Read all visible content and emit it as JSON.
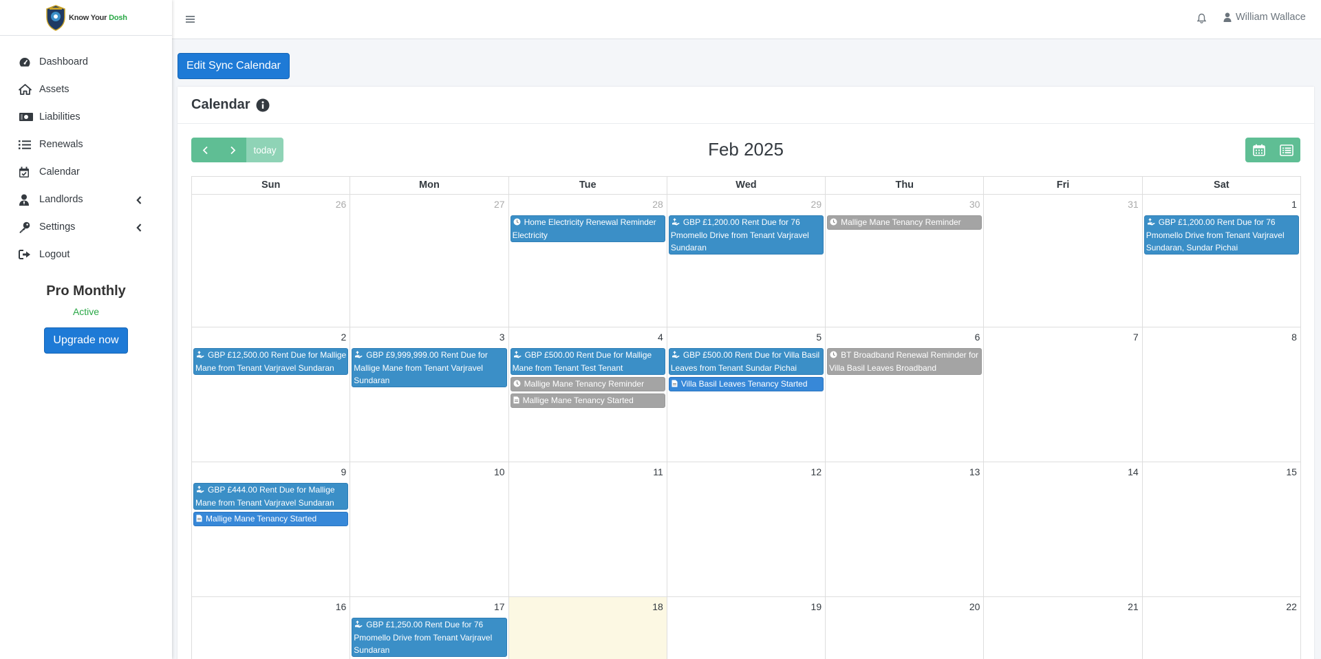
{
  "brand": {
    "name_part1": "Know Your ",
    "name_part2": "Dosh"
  },
  "sidebar": {
    "items": [
      {
        "label": "Dashboard",
        "icon": "tachometer-icon"
      },
      {
        "label": "Assets",
        "icon": "home-icon"
      },
      {
        "label": "Liabilities",
        "icon": "money-icon"
      },
      {
        "label": "Renewals",
        "icon": "list-icon"
      },
      {
        "label": "Calendar",
        "icon": "calendar-check-icon"
      },
      {
        "label": "Landlords",
        "icon": "user-tie-icon",
        "has_children": true
      },
      {
        "label": "Settings",
        "icon": "key-icon",
        "has_children": true
      },
      {
        "label": "Logout",
        "icon": "sign-out-icon"
      }
    ],
    "plan": {
      "name": "Pro Monthly",
      "status": "Active",
      "upgrade_label": "Upgrade now"
    }
  },
  "navbar": {
    "user_name": "William Wallace"
  },
  "content": {
    "sync_button": "Edit Sync Calendar",
    "card_title": "Calendar"
  },
  "calendar": {
    "title": "Feb 2025",
    "today_label": "today",
    "days_of_week": [
      "Sun",
      "Mon",
      "Tue",
      "Wed",
      "Thu",
      "Fri",
      "Sat"
    ],
    "weeks": [
      [
        {
          "num": "26",
          "other": true,
          "events": []
        },
        {
          "num": "27",
          "other": true,
          "events": []
        },
        {
          "num": "28",
          "other": true,
          "events": [
            {
              "kind": "blue",
              "icon": "clock",
              "text": "Home Electricity Renewal Reminder Electricity"
            }
          ]
        },
        {
          "num": "29",
          "other": true,
          "events": [
            {
              "kind": "blue",
              "icon": "hand",
              "text": "GBP £1,200.00 Rent Due for 76 Pmomello Drive from Tenant Varjravel Sundaran"
            }
          ]
        },
        {
          "num": "30",
          "other": true,
          "events": [
            {
              "kind": "grey",
              "icon": "clock",
              "text": "Mallige Mane Tenancy Reminder"
            }
          ]
        },
        {
          "num": "31",
          "other": true,
          "events": []
        },
        {
          "num": "1",
          "events": [
            {
              "kind": "blue",
              "icon": "hand",
              "text": "GBP £1,200.00 Rent Due for 76 Pmomello Drive from Tenant Varjravel Sundaran, Sundar Pichai"
            }
          ]
        }
      ],
      [
        {
          "num": "2",
          "events": [
            {
              "kind": "blue",
              "icon": "hand",
              "text": "GBP £12,500.00 Rent Due for Mallige Mane from Tenant Varjravel Sundaran"
            }
          ]
        },
        {
          "num": "3",
          "events": [
            {
              "kind": "blue",
              "icon": "hand",
              "text": "GBP £9,999,999.00 Rent Due for Mallige Mane from Tenant Varjravel Sundaran"
            }
          ]
        },
        {
          "num": "4",
          "events": [
            {
              "kind": "blue",
              "icon": "hand",
              "text": "GBP £500.00 Rent Due for Mallige Mane from Tenant Test Tenant"
            },
            {
              "kind": "grey",
              "icon": "clock",
              "text": "Mallige Mane Tenancy Reminder"
            },
            {
              "kind": "grey",
              "icon": "doc",
              "text": "Mallige Mane Tenancy Started"
            }
          ]
        },
        {
          "num": "5",
          "events": [
            {
              "kind": "blue",
              "icon": "hand",
              "text": "GBP £500.00 Rent Due for Villa Basil Leaves from Tenant Sundar Pichai"
            },
            {
              "kind": "brt",
              "icon": "doc",
              "text": "Villa Basil Leaves Tenancy Started"
            }
          ]
        },
        {
          "num": "6",
          "events": [
            {
              "kind": "grey",
              "icon": "clock",
              "text": "BT Broadband Renewal Reminder for Villa Basil Leaves Broadband"
            }
          ]
        },
        {
          "num": "7",
          "events": []
        },
        {
          "num": "8",
          "events": []
        }
      ],
      [
        {
          "num": "9",
          "events": [
            {
              "kind": "blue",
              "icon": "hand",
              "text": "GBP £444.00 Rent Due for Mallige Mane from Tenant Varjravel Sundaran"
            },
            {
              "kind": "brt",
              "icon": "doc",
              "text": "Mallige Mane Tenancy Started"
            }
          ]
        },
        {
          "num": "10",
          "events": []
        },
        {
          "num": "11",
          "events": []
        },
        {
          "num": "12",
          "events": []
        },
        {
          "num": "13",
          "events": []
        },
        {
          "num": "14",
          "events": []
        },
        {
          "num": "15",
          "events": []
        }
      ],
      [
        {
          "num": "16",
          "events": []
        },
        {
          "num": "17",
          "events": [
            {
              "kind": "blue",
              "icon": "hand",
              "text": "GBP £1,250.00 Rent Due for 76 Pmomello Drive from Tenant Varjravel Sundaran"
            }
          ]
        },
        {
          "num": "18",
          "today": true,
          "events": []
        },
        {
          "num": "19",
          "events": []
        },
        {
          "num": "20",
          "events": []
        },
        {
          "num": "21",
          "events": []
        },
        {
          "num": "22",
          "events": []
        }
      ]
    ]
  }
}
